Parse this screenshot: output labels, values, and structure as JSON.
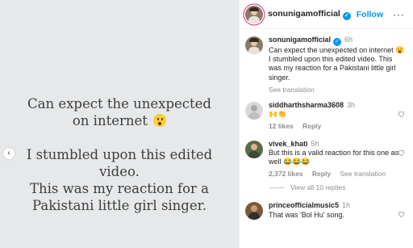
{
  "media": {
    "line1": "Can expect the unexpected",
    "line2": "on internet",
    "emoji": "astonished-face",
    "line3": "I stumbled upon this edited",
    "line4": "video.",
    "line5": "This was my reaction for a",
    "line6": "Pakistani little girl singer.",
    "prev_icon": "chevron-left"
  },
  "header": {
    "username": "sonunigamofficial",
    "follow_label": "Follow",
    "more_label": "···"
  },
  "caption": {
    "username": "sonunigamofficial",
    "time": "6h",
    "text1": "Can expect the unexpected on internet 😮",
    "text2": "I stumbled upon this edited video. This was my reaction for a Pakistani little girl singer.",
    "see_translation": "See translation"
  },
  "comments": [
    {
      "username": "siddharthsharma3608",
      "time": "3h",
      "text": "🙌👏",
      "likes": "12 likes",
      "reply": "Reply"
    },
    {
      "username": "vivek_khati",
      "time": "5h",
      "text": "But this is a valid reaction for this one as well 😂😂😂",
      "likes": "2,372 likes",
      "reply": "Reply",
      "see_translation": "See translation",
      "view_replies": "View all 10 replies"
    },
    {
      "username": "princeofficialmusic5",
      "time": "1h",
      "text": "That was 'Bol Hu' song."
    }
  ],
  "colors": {
    "accent": "#0095f6",
    "media_bg": "#e6e8ea",
    "muted": "#8e8e8e"
  }
}
